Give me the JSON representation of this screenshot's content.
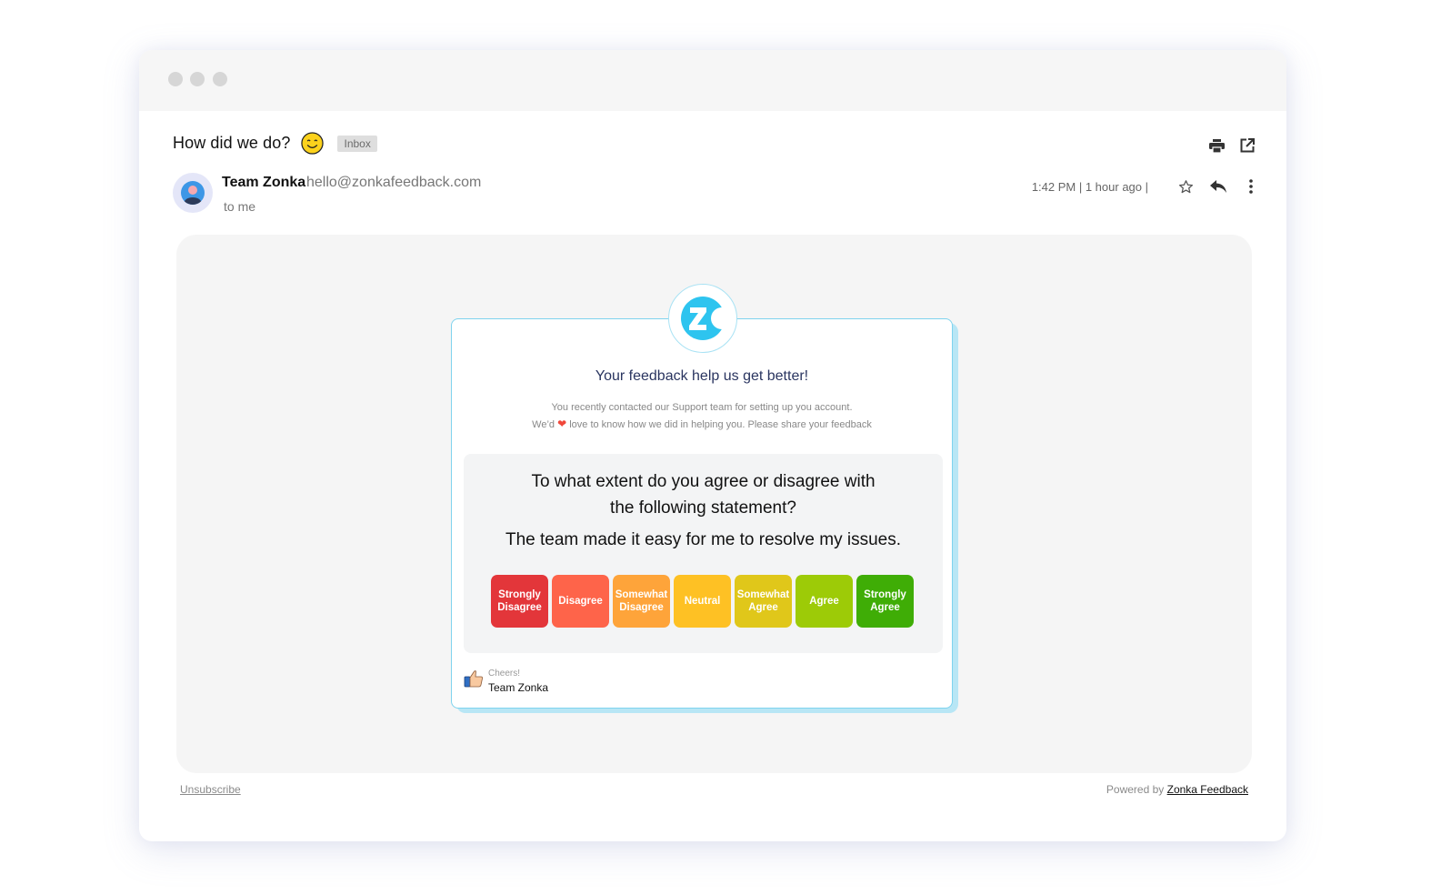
{
  "window": {
    "controls": [
      "close",
      "minimize",
      "maximize"
    ]
  },
  "email": {
    "subject": "How did we do?",
    "subject_emoji": "smiling-face-icon",
    "label": "Inbox",
    "top_actions": [
      {
        "name": "print",
        "icon": "print-icon"
      },
      {
        "name": "open-in-new-window",
        "icon": "external-link-icon"
      }
    ],
    "sender": {
      "name": "Team Zonka",
      "email": "hello@zonkafeedback.com",
      "recipient": "to me"
    },
    "meta": {
      "time": "1:42 PM | 1 hour ago |"
    },
    "meta_actions": [
      {
        "name": "star",
        "icon": "star-icon"
      },
      {
        "name": "reply",
        "icon": "reply-icon"
      },
      {
        "name": "more",
        "icon": "more-vertical-icon"
      }
    ]
  },
  "survey": {
    "title": "Your feedback help us get better!",
    "description_line1": "You recently contacted our Support team for setting up you account.",
    "description_line2_pre": "We’d",
    "description_line2_heart": "❤",
    "description_line2_post": "love to know how we did in helping you. Please share your feedback",
    "question": "To what extent do you agree or disagree with the following statement?",
    "statement": "The team made it easy for me to resolve my issues.",
    "options": [
      {
        "label": "Strongly Disagree",
        "color": "#e3363a"
      },
      {
        "label": "Disagree",
        "color": "#fe644a"
      },
      {
        "label": "Somewhat Disagree",
        "color": "#fea43a"
      },
      {
        "label": "Neutral",
        "color": "#fec124"
      },
      {
        "label": "Somewhat Agree",
        "color": "#e0c71a"
      },
      {
        "label": "Agree",
        "color": "#9dcb07"
      },
      {
        "label": "Strongly Agree",
        "color": "#3fad06"
      }
    ],
    "signoff": {
      "cheers": "Cheers!",
      "team": "Team Zonka"
    }
  },
  "footer": {
    "unsubscribe": "Unsubscribe",
    "powered_by": "Powered by",
    "brand_link": "Zonka Feedback"
  },
  "colors": {
    "brand": "#2ec4ef",
    "title": "#2a3560"
  }
}
